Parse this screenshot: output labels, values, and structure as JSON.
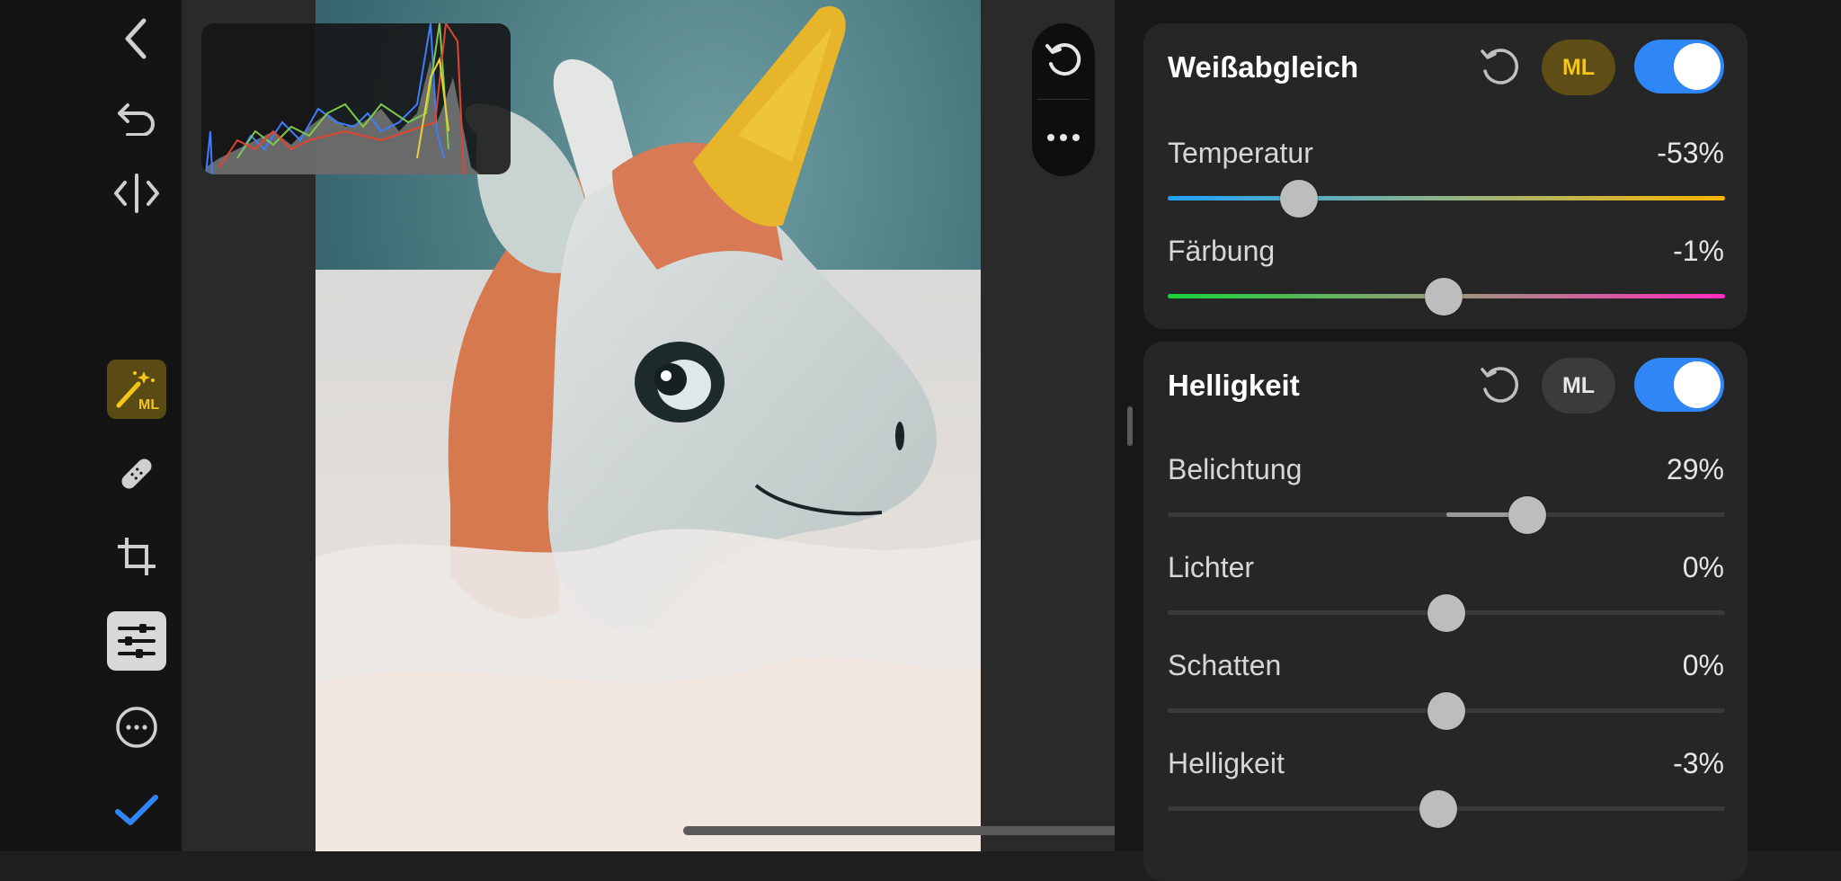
{
  "toolbar": {
    "items": [
      {
        "name": "back",
        "icon": "chevron-left-icon"
      },
      {
        "name": "undo",
        "icon": "undo-icon"
      },
      {
        "name": "compare",
        "icon": "compare-icon"
      },
      {
        "name": "ml-auto",
        "icon": "magic-wand-ml-icon",
        "badge": "ML"
      },
      {
        "name": "heal",
        "icon": "bandage-icon"
      },
      {
        "name": "crop",
        "icon": "crop-icon"
      },
      {
        "name": "adjust",
        "icon": "sliders-icon"
      },
      {
        "name": "more",
        "icon": "ellipsis-circle-icon"
      },
      {
        "name": "done",
        "icon": "checkmark-icon"
      }
    ]
  },
  "canvas": {
    "floating_actions": [
      "rotate-reset-icon",
      "ellipsis-icon"
    ]
  },
  "panel": {
    "white_balance": {
      "title": "Weißabgleich",
      "ml_label": "ML",
      "ml_active": true,
      "enabled": true,
      "rows": [
        {
          "label": "Temperatur",
          "value": "-53%",
          "level": -0.53
        },
        {
          "label": "Färbung",
          "value": "-1%",
          "level": -0.01
        }
      ]
    },
    "brightness": {
      "title": "Helligkeit",
      "ml_label": "ML",
      "ml_active": false,
      "enabled": true,
      "rows": [
        {
          "label": "Belichtung",
          "value": "29%",
          "level": 0.29
        },
        {
          "label": "Lichter",
          "value": "0%",
          "level": 0
        },
        {
          "label": "Schatten",
          "value": "0%",
          "level": 0
        },
        {
          "label": "Helligkeit",
          "value": "-3%",
          "level": -0.03
        }
      ]
    }
  },
  "colors": {
    "accent": "#2f86f6",
    "ml_gold": "#f5c518",
    "done_blue": "#2f86f6"
  }
}
